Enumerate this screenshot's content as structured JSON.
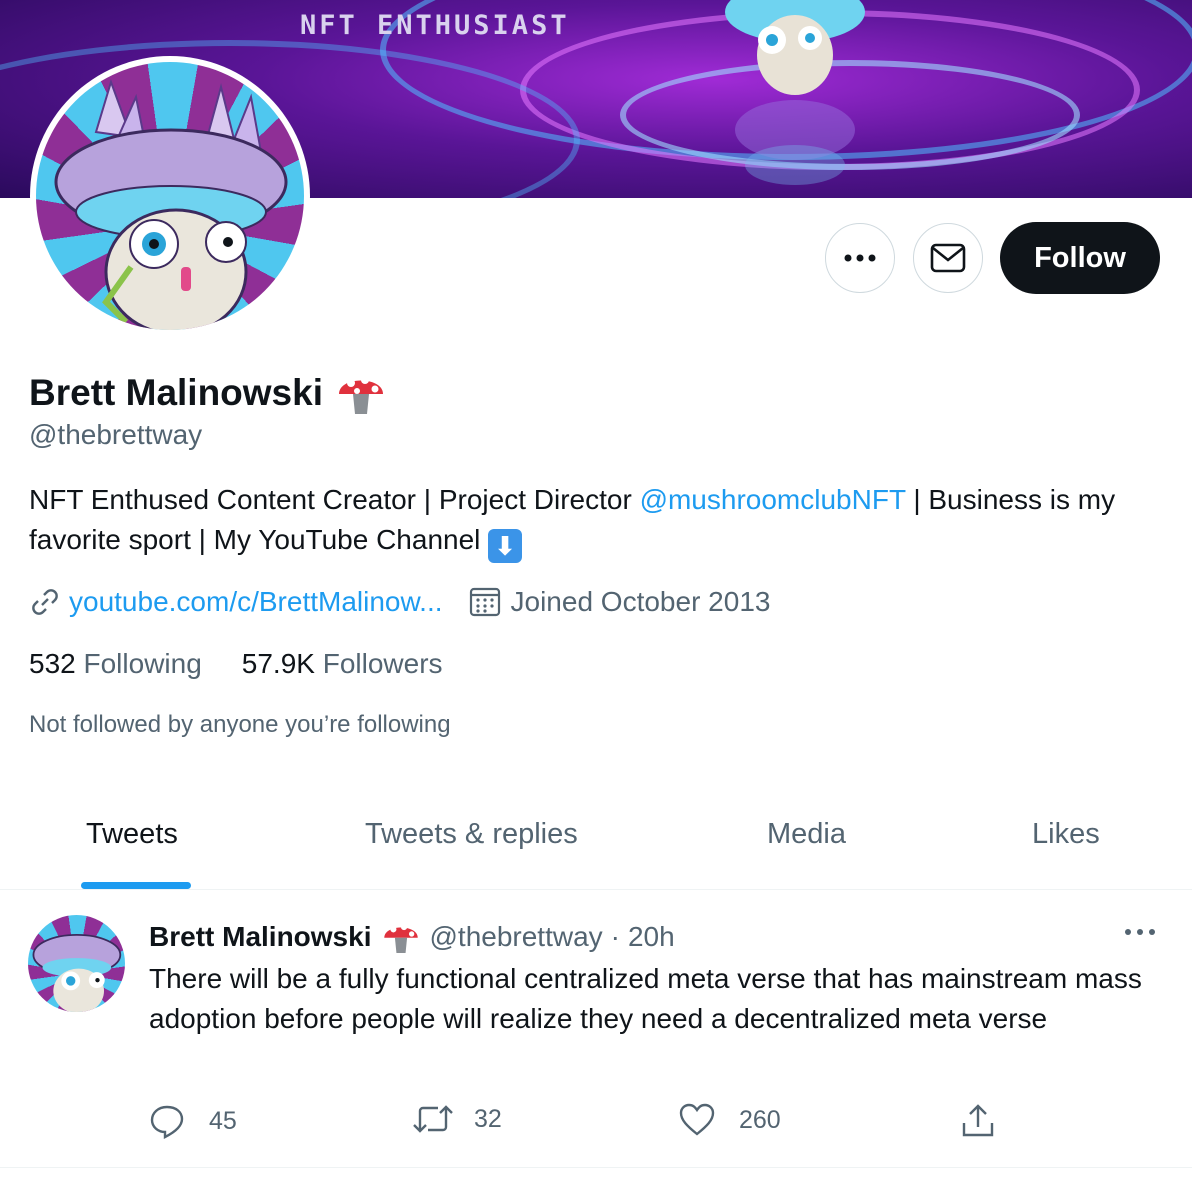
{
  "banner": {
    "text": "NFT ENTHUSIAST"
  },
  "profile": {
    "name": "Brett Malinowski",
    "handle": "@thebrettway",
    "bio_part1": "NFT Enthused Content Creator | Project Director ",
    "bio_mention": "@mushroomclubNFT",
    "bio_part2": " | Business is my favorite sport | My YouTube Channel ",
    "link": "youtube.com/c/BrettMalinow...",
    "joined": "Joined October 2013",
    "following_count": "532",
    "following_label": "Following",
    "followers_count": "57.9K",
    "followers_label": "Followers",
    "not_followed": "Not followed by anyone you’re following"
  },
  "actions": {
    "follow_label": "Follow"
  },
  "tabs": [
    {
      "label": "Tweets",
      "active": true
    },
    {
      "label": "Tweets & replies",
      "active": false
    },
    {
      "label": "Media",
      "active": false
    },
    {
      "label": "Likes",
      "active": false
    }
  ],
  "tweet": {
    "name": "Brett Malinowski",
    "handle": "@thebrettway",
    "separator": "·",
    "time": "20h",
    "text": "There will be a fully functional centralized meta verse that has mainstream mass adoption before people will realize they need a decentralized meta verse",
    "replies": "45",
    "retweets": "32",
    "likes": "260"
  },
  "colors": {
    "accent": "#1d9bf0",
    "text": "#0f1419",
    "secondary": "#536471",
    "follow_bg": "#0f1419"
  },
  "icons": [
    "more-icon",
    "mail-icon",
    "mushroom-icon",
    "down-arrow-icon",
    "link-icon",
    "calendar-icon",
    "reply-icon",
    "retweet-icon",
    "like-icon",
    "share-icon"
  ]
}
